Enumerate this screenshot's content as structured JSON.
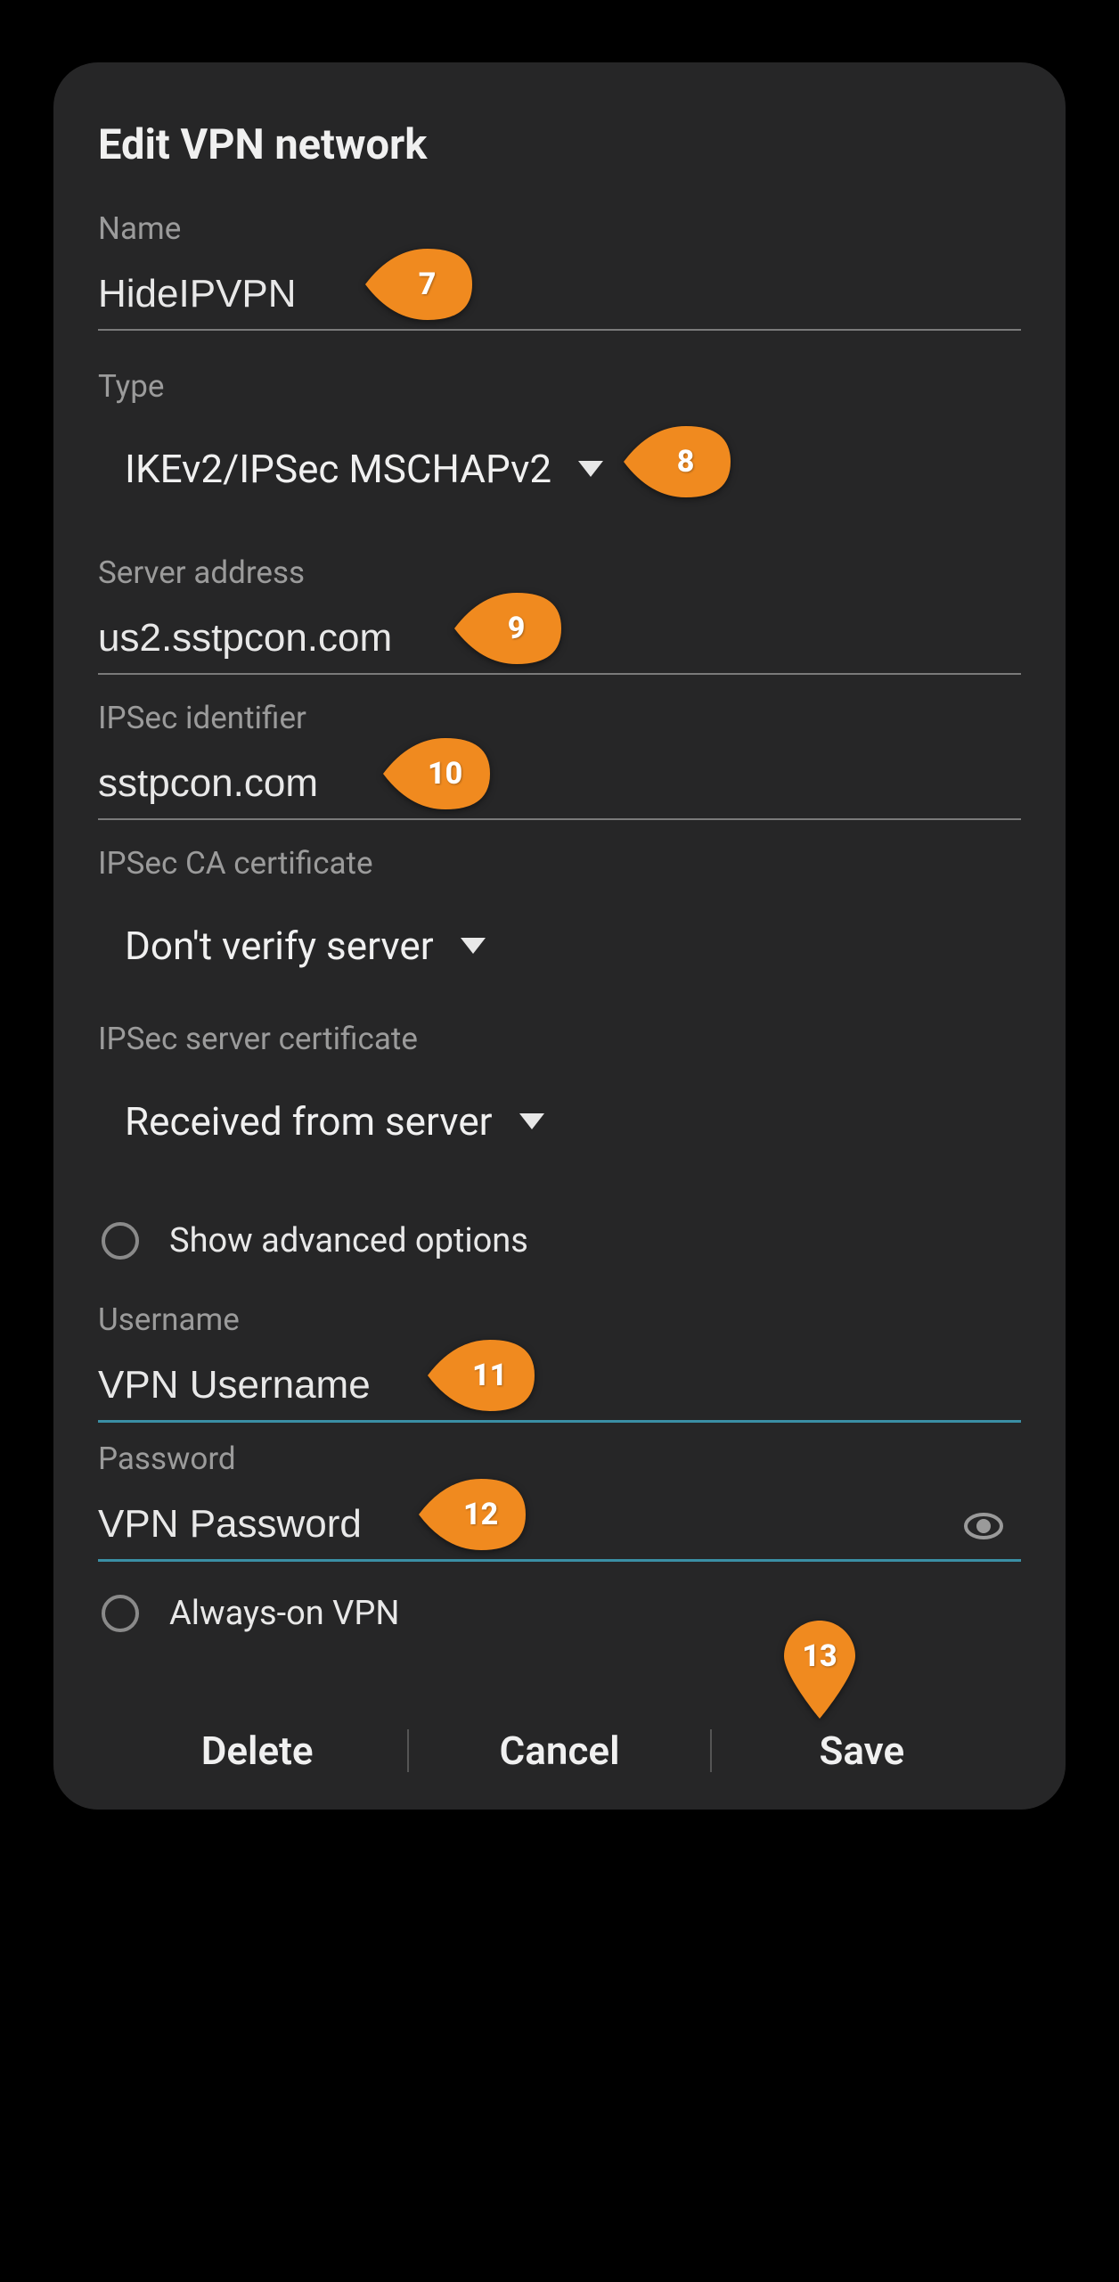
{
  "dialog": {
    "title": "Edit VPN network",
    "name": {
      "label": "Name",
      "value": "HideIPVPN"
    },
    "type": {
      "label": "Type",
      "value": "IKEv2/IPSec MSCHAPv2"
    },
    "server_address": {
      "label": "Server address",
      "value": "us2.sstpcon.com"
    },
    "ipsec_identifier": {
      "label": "IPSec identifier",
      "value": "sstpcon.com"
    },
    "ipsec_ca_cert": {
      "label": "IPSec CA certificate",
      "value": "Don't verify server"
    },
    "ipsec_server_cert": {
      "label": "IPSec server certificate",
      "value": "Received from server"
    },
    "show_advanced": {
      "label": "Show advanced options",
      "checked": false
    },
    "username": {
      "label": "Username",
      "value": "VPN Username"
    },
    "password": {
      "label": "Password",
      "value": "VPN Password"
    },
    "always_on": {
      "label": "Always-on VPN",
      "checked": false
    },
    "buttons": {
      "delete": "Delete",
      "cancel": "Cancel",
      "save": "Save"
    }
  },
  "markers": {
    "m7": "7",
    "m8": "8",
    "m9": "9",
    "m10": "10",
    "m11": "11",
    "m12": "12",
    "m13": "13"
  },
  "colors": {
    "marker": "#f08a1f",
    "accent_underline": "#3a8fa5"
  }
}
